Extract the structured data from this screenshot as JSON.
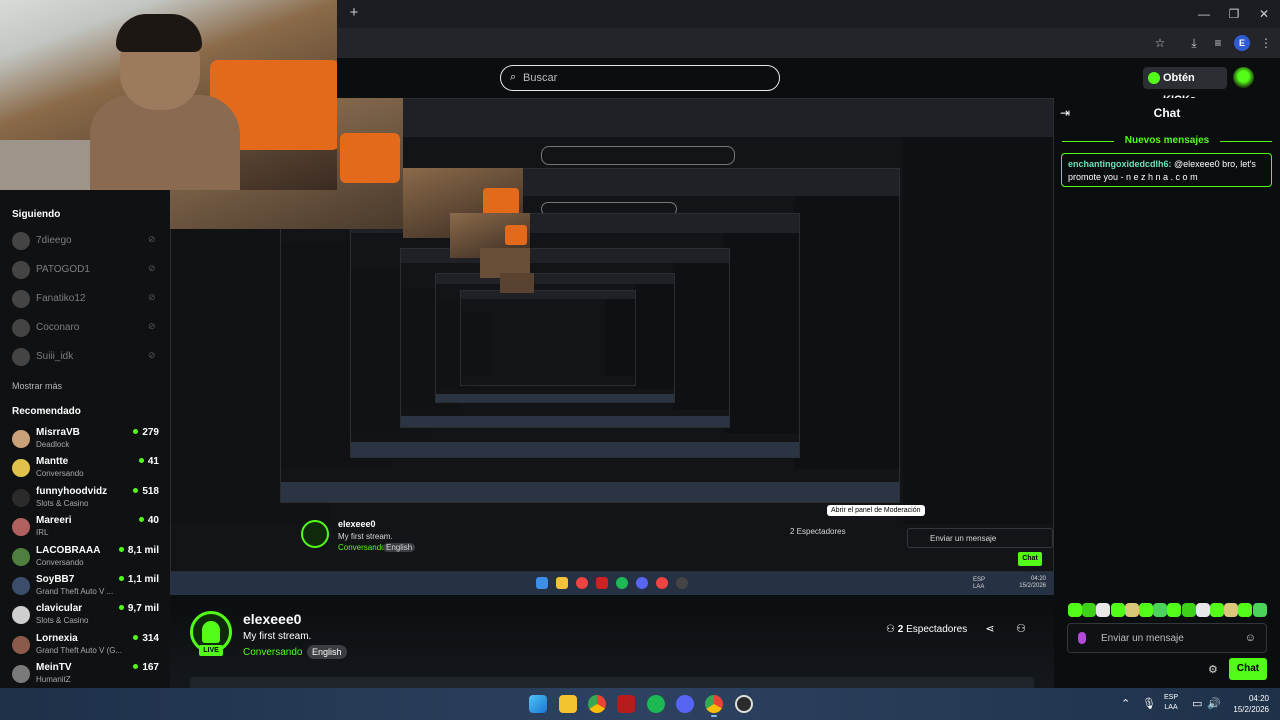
{
  "browser": {
    "newtab_icon": "+",
    "window_controls": [
      "—",
      "❐",
      "✕"
    ],
    "toolbar_icons": [
      "star-icon",
      "download-icon",
      "playlist-icon",
      "profile-icon",
      "kebab-icon"
    ],
    "profile_initial": "E"
  },
  "header": {
    "search_placeholder": "Buscar",
    "kicks_button": "Obtén KICKs"
  },
  "sidebar": {
    "following_title": "Siguiendo",
    "following": [
      {
        "name": "7dieego"
      },
      {
        "name": "PATOGOD1"
      },
      {
        "name": "Fanatiko12"
      },
      {
        "name": "Coconaro"
      },
      {
        "name": "Suiii_idk"
      }
    ],
    "show_more": "Mostrar más",
    "recommended_title": "Recomendado",
    "recommended": [
      {
        "name": "MisrraVB",
        "category": "Deadlock",
        "viewers": "279",
        "color": "#c9a27a"
      },
      {
        "name": "Mantte",
        "category": "Conversando",
        "viewers": "41",
        "color": "#e0c24a"
      },
      {
        "name": "funnyhoodvidz",
        "category": "Slots & Casino",
        "viewers": "518",
        "color": "#2b2b2b"
      },
      {
        "name": "Mareeri",
        "category": "IRL",
        "viewers": "40",
        "color": "#b0615f"
      },
      {
        "name": "LACOBRAAA",
        "category": "Conversando",
        "viewers": "8,1 mil",
        "color": "#4e7f3e"
      },
      {
        "name": "SoyBB7",
        "category": "Grand Theft Auto V ...",
        "viewers": "1,1 mil",
        "color": "#3b4d6b"
      },
      {
        "name": "clavicular",
        "category": "Slots & Casino",
        "viewers": "9,7 mil",
        "color": "#cfcfcf"
      },
      {
        "name": "Lornexia",
        "category": "Grand Theft Auto V (G...",
        "viewers": "314",
        "color": "#8c5a4a"
      },
      {
        "name": "MeinTV",
        "category": "HumanitZ",
        "viewers": "167",
        "color": "#7a7a7a"
      }
    ]
  },
  "video_overlay": {
    "inner_streamer": "elexeee0",
    "inner_title": "My first stream.",
    "inner_category": "Conversando",
    "inner_lang": "English",
    "inner_viewers": "2 Espectadores",
    "inner_tooltip": "Abrir el panel de Moderación",
    "inner_chat_placeholder": "Enviar un mensaje",
    "inner_chat_button": "Chat",
    "inner_clock_time": "04:20",
    "inner_clock_date": "15/2/2026",
    "inner_lang_code": "ESP\nLAA"
  },
  "stream": {
    "streamer": "elexeee0",
    "title": "My first stream.",
    "category": "Conversando",
    "language": "English",
    "live_badge": "LIVE",
    "viewers_count": "2",
    "viewers_label": "Espectadores"
  },
  "chat": {
    "title": "Chat",
    "new_messages": "Nuevos mensajes",
    "pinned_user": "enchantingoxidedcdlh6:",
    "pinned_text": " @elexeee0 bro, let's promote you - n e z h n  a . c o  m",
    "input_placeholder": "Enviar un mensaje",
    "send_button": "Chat",
    "accent": "#53fc18"
  },
  "taskbar": {
    "lang_line1": "ESP",
    "lang_line2": "LAA",
    "time": "04:20",
    "date": "15/2/2026",
    "app_icons": [
      "windows-start-icon",
      "file-explorer-icon",
      "chrome-icon",
      "voicemeeter-icon",
      "spotify-icon",
      "discord-icon",
      "chrome-profile-icon",
      "obs-icon"
    ]
  }
}
